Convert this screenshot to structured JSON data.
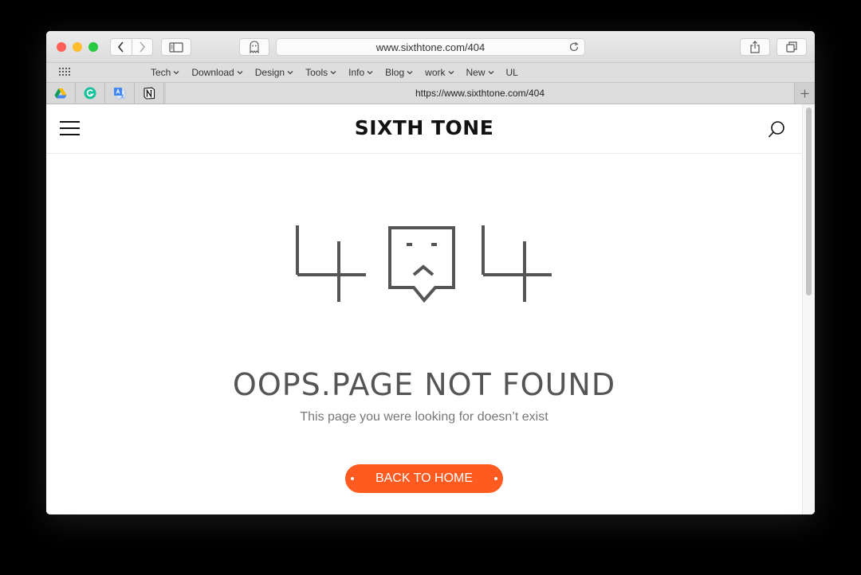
{
  "browser": {
    "address": "www.sixthtone.com/404",
    "bookmarks": [
      {
        "label": "Tech",
        "dropdown": true
      },
      {
        "label": "Download",
        "dropdown": true
      },
      {
        "label": "Design",
        "dropdown": true
      },
      {
        "label": "Tools",
        "dropdown": true
      },
      {
        "label": "Info",
        "dropdown": true
      },
      {
        "label": "Blog",
        "dropdown": true
      },
      {
        "label": "work",
        "dropdown": true
      },
      {
        "label": "New",
        "dropdown": true
      },
      {
        "label": "UL",
        "dropdown": false
      }
    ],
    "pinned_tabs": [
      {
        "icon": "google-drive-icon"
      },
      {
        "icon": "grammarly-icon"
      },
      {
        "icon": "google-translate-icon"
      },
      {
        "icon": "notion-icon"
      }
    ],
    "active_tab_title": "https://www.sixthtone.com/404",
    "traffic_colors": [
      "#ff5f57",
      "#febc2e",
      "#28c840"
    ]
  },
  "site": {
    "logo": "SIXTH TONE"
  },
  "error": {
    "code_left": "4",
    "code_right": "4",
    "headline": "OOPS.PAGE NOT FOUND",
    "message": "This page you were looking for doesn’t exist",
    "button_label": "BACK TO HOME"
  },
  "colors": {
    "accent": "#ff5a1f",
    "illustration": "#555555",
    "headline": "#555555"
  }
}
